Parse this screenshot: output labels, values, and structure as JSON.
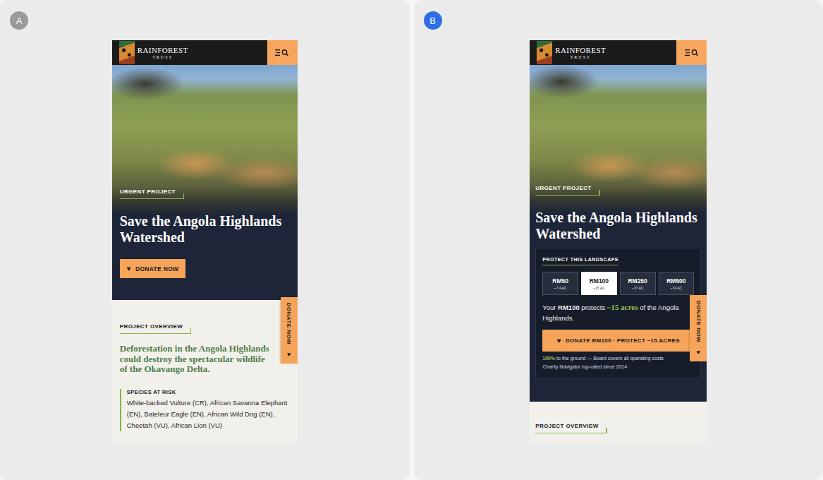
{
  "panels": [
    {
      "badge": "A",
      "badge_color": "#9a9a9a",
      "kind": "simple",
      "logo": {
        "name": "RAINFOREST",
        "sub": "TRUST"
      },
      "hero": {
        "tag": "URGENT PROJECT",
        "title": "Save the Angola Highlands Watershed",
        "button": {
          "icon": "♥",
          "label": "DONATE NOW"
        }
      },
      "overview": {
        "label": "PROJECT OVERVIEW",
        "headline": "Deforestation in the Angola Highlands could destroy the spectacular wildlife of the Okavango Delta.",
        "species_label": "SPECIES AT RISK",
        "species": "White-backed Vulture (CR), African Savanna Elephant (EN), Bateleur Eagle (EN), African Wild Dog (EN), Cheetah (VU), African Lion (VU)"
      },
      "side_tab": {
        "icon": "♥",
        "label": "DONATE NOW"
      }
    },
    {
      "badge": "B",
      "badge_color": "#2f6fe4",
      "kind": "amount-picker",
      "logo": {
        "name": "RAINFOREST",
        "sub": "TRUST"
      },
      "hero": {
        "tag": "URGENT PROJECT",
        "title": "Save the Angola Highlands Watershed"
      },
      "donate_card": {
        "title": "PROTECT THIS LANDSCAPE",
        "amounts": [
          {
            "amount": "RM50",
            "acres": "~7.4 AC",
            "selected": false
          },
          {
            "amount": "RM100",
            "acres": "~15 AC",
            "selected": true
          },
          {
            "amount": "RM250",
            "acres": "~37 AC",
            "selected": false
          },
          {
            "amount": "RM500",
            "acres": "~74 AC",
            "selected": false
          }
        ],
        "summary": [
          {
            "text": "Your ",
            "kind": "plain"
          },
          {
            "text": "RM100",
            "kind": "bold"
          },
          {
            "text": " protects ",
            "kind": "plain"
          },
          {
            "text": "~15 acres",
            "kind": "accent"
          },
          {
            "text": " of the Angola Highlands.",
            "kind": "plain"
          }
        ],
        "button": {
          "icon": "♥",
          "label": "DONATE RM100 · PROTECT ~15 ACRES"
        },
        "guarantee": [
          {
            "text": "100%",
            "kind": "accent"
          },
          {
            "text": " to the ground — Board covers all operating costs.",
            "kind": "plain"
          }
        ],
        "rating": "Charity Navigator top-rated since 2014"
      },
      "overview": {
        "label": "PROJECT OVERVIEW"
      },
      "side_tab": {
        "icon": "♥",
        "label": "DONATE NOW"
      }
    }
  ]
}
